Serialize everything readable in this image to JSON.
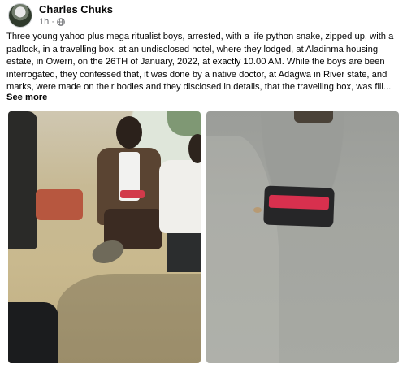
{
  "post": {
    "author": "Charles Chuks",
    "time": "1h",
    "separator": "·",
    "privacy_icon": "globe-icon",
    "text": "Three young yahoo plus mega ritualist boys, arrested, with a life python snake, zipped up, with a padlock, in a travelling box, at an undisclosed hotel, where they lodged, at Aladinma housing estate, in Owerri, on the 26TH of January, 2022, at exactly 10.00 AM. While the boys are been interrogated, they confessed that, it was done by a native doctor, at Adagwa in River state, and marks, were made on their bodies and they disclosed in details, that the travelling box, was fill...",
    "see_more": "See more"
  },
  "photos": [
    {
      "description": "Young men seated on the ground under arrest",
      "kind": "photo"
    },
    {
      "description": "Black travelling box with red band on a road",
      "kind": "photo"
    }
  ],
  "colors": {
    "text": "#050505",
    "secondary": "#65676b",
    "background": "#ffffff"
  }
}
